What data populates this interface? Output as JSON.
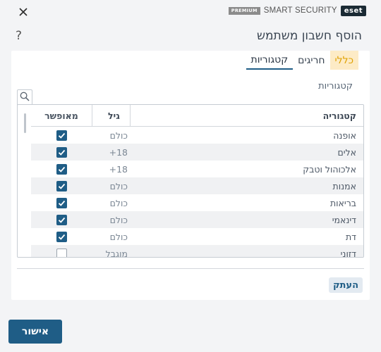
{
  "window": {
    "title": "הוסף חשבון משתמש",
    "help_label": "?",
    "brand": {
      "logo": "eset",
      "name": "SMART SECURITY",
      "edition": "PREMIUM"
    },
    "icons": {
      "close": "close-icon",
      "help": "help-icon",
      "search": "search-icon"
    }
  },
  "tabs": [
    {
      "label": "כללי",
      "state": "highlighted"
    },
    {
      "label": "חריגים",
      "state": "normal"
    },
    {
      "label": "קטגוריות",
      "state": "active"
    }
  ],
  "categories_label": "קטגוריות",
  "grid": {
    "columns": {
      "category": "קטגוריה",
      "age": "גיל",
      "allowed": "מאופשר"
    },
    "rows": [
      {
        "category": "אופנה",
        "age": "כולם",
        "allowed": true
      },
      {
        "category": "אלים",
        "age": "+18",
        "allowed": true
      },
      {
        "category": "אלכוהול וטבק",
        "age": "+18",
        "allowed": true
      },
      {
        "category": "אמנות",
        "age": "כולם",
        "allowed": true
      },
      {
        "category": "בריאות",
        "age": "כולם",
        "allowed": true
      },
      {
        "category": "דינאמי",
        "age": "כולם",
        "allowed": true
      },
      {
        "category": "דת",
        "age": "כולם",
        "allowed": true
      },
      {
        "category": "דזוני",
        "age": "מוגבל",
        "allowed": false
      }
    ]
  },
  "buttons": {
    "copy": "העתק",
    "ok": "אישור"
  },
  "colors": {
    "accent": "#1f5d86",
    "tab_highlight": "#fdebc6",
    "tab_highlight_text": "#e0a100"
  }
}
